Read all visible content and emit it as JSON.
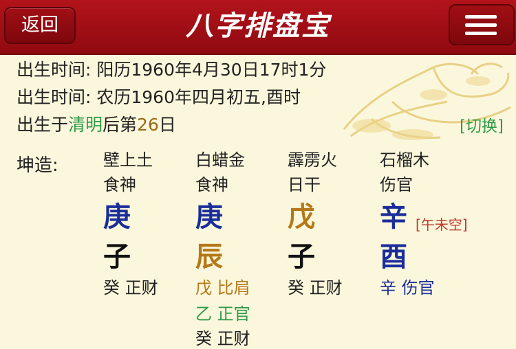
{
  "header": {
    "back_label": "返回",
    "title": "八字排盘宝",
    "menu_icon": "hamburger-menu-icon"
  },
  "birth": {
    "solar_prefix": "出生时间: ",
    "solar_value": "阳历1960年4月30日17时1分",
    "lunar_prefix": "出生时间: ",
    "lunar_value": "农历1960年四月初五,酉时",
    "term_prefix": "出生于",
    "term_name": "清明",
    "term_mid": "后第",
    "term_days": "26",
    "term_suffix": "日",
    "switch_label": "[切换]"
  },
  "chart": {
    "gender_label": "坤造:",
    "empty_label": "[午未空]",
    "pillars": [
      {
        "nayin": "壁上土",
        "ten_god": "食神",
        "stem": "庚",
        "branch": "子",
        "hidden": [
          {
            "stem": "癸",
            "god": "正财"
          }
        ]
      },
      {
        "nayin": "白蜡金",
        "ten_god": "食神",
        "stem": "庚",
        "branch": "辰",
        "hidden": [
          {
            "stem": "戊",
            "god": "比肩"
          },
          {
            "stem": "乙",
            "god": "正官"
          },
          {
            "stem": "癸",
            "god": "正财"
          }
        ]
      },
      {
        "nayin": "霹雳火",
        "ten_god": "日干",
        "stem": "戊",
        "branch": "子",
        "hidden": [
          {
            "stem": "癸",
            "god": "正财"
          }
        ]
      },
      {
        "nayin": "石榴木",
        "ten_god": "伤官",
        "stem": "辛",
        "branch": "酉",
        "hidden": [
          {
            "stem": "辛",
            "god": "伤官"
          }
        ]
      }
    ]
  },
  "colors": {
    "header_red": "#a51118",
    "background": "#fbf7dc",
    "metal_blue": "#1a2d9a",
    "earth_gold": "#b57818",
    "wood_green": "#2e9a46",
    "water_dark": "#111111"
  }
}
